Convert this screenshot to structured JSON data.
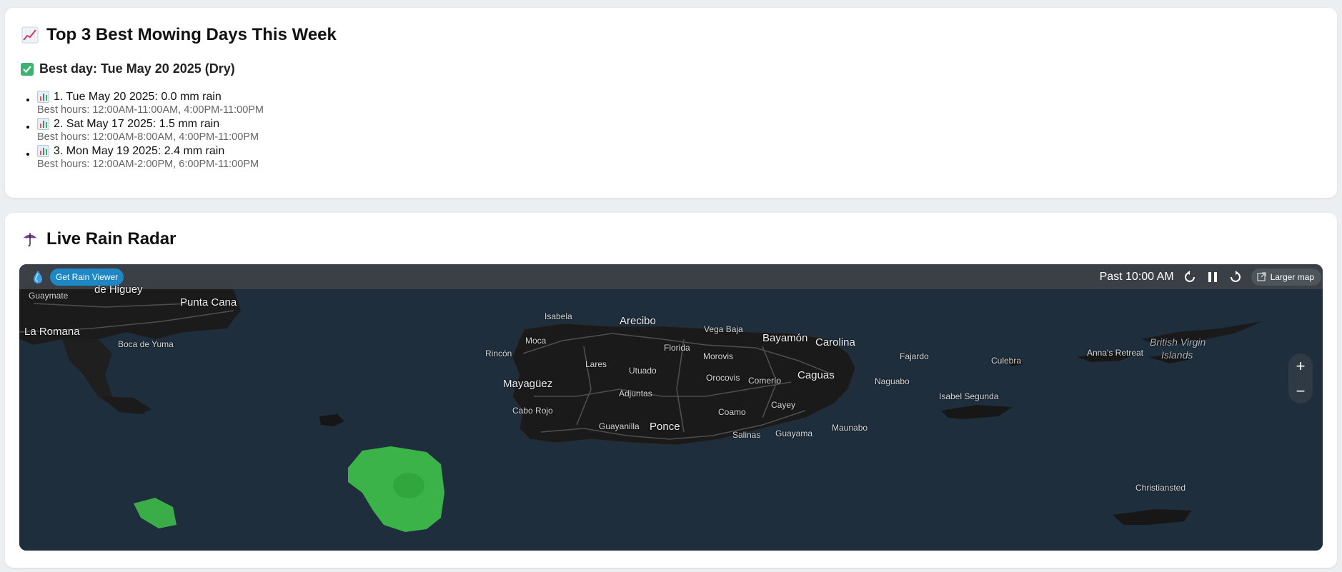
{
  "mowing": {
    "title": "Top 3 Best Mowing Days This Week",
    "best_day": "Best day: Tue May 20 2025 (Dry)",
    "days": [
      {
        "label": "1. Tue May 20 2025: 0.0 mm rain",
        "hours": "Best hours: 12:00AM-11:00AM, 4:00PM-11:00PM"
      },
      {
        "label": "2. Sat May 17 2025: 1.5 mm rain",
        "hours": "Best hours: 12:00AM-8:00AM, 4:00PM-11:00PM"
      },
      {
        "label": "3. Mon May 19 2025: 2.4 mm rain",
        "hours": "Best hours: 12:00AM-2:00PM, 6:00PM-11:00PM"
      }
    ]
  },
  "radar": {
    "title": "Live Rain Radar",
    "get_button": "Get Rain Viewer",
    "time": "Past 10:00 AM",
    "larger_map": "Larger map",
    "zoom_in": "+",
    "zoom_out": "−",
    "places": [
      "Guaymate",
      "de Higuey",
      "Punta Cana",
      "La Romana",
      "Boca de Yuma",
      "Isabela",
      "Arecibo",
      "Vega Baja",
      "Bayamón",
      "Carolina",
      "Moca",
      "Rincón",
      "Florida",
      "Lares",
      "Morovis",
      "Fajardo",
      "Utuado",
      "Mayagüez",
      "Orocovis",
      "Comerío",
      "Caguas",
      "Naguabo",
      "Adjuntas",
      "Culebra",
      "Anna's Retreat",
      "British Virgin",
      "Islands",
      "Cabo Rojo",
      "Cayey",
      "Coamo",
      "Isabel Segunda",
      "Guayanilla",
      "Ponce",
      "Salinas",
      "Guayama",
      "Maunabo",
      "Christiansted"
    ]
  },
  "colors": {
    "background": "#eceff1",
    "card": "#ffffff",
    "radar_bar": "#3a4045",
    "map_water": "#1e2e3d",
    "map_land": "#1b1b1b",
    "rain_green": "#3fc24a",
    "button_blue": "#1e88c7"
  },
  "icons": [
    "chart-increasing-icon",
    "check-mark-icon",
    "bar-chart-icon",
    "umbrella-icon",
    "rainviewer-logo-icon",
    "rewind-icon",
    "pause-icon",
    "forward-icon",
    "external-link-icon"
  ]
}
